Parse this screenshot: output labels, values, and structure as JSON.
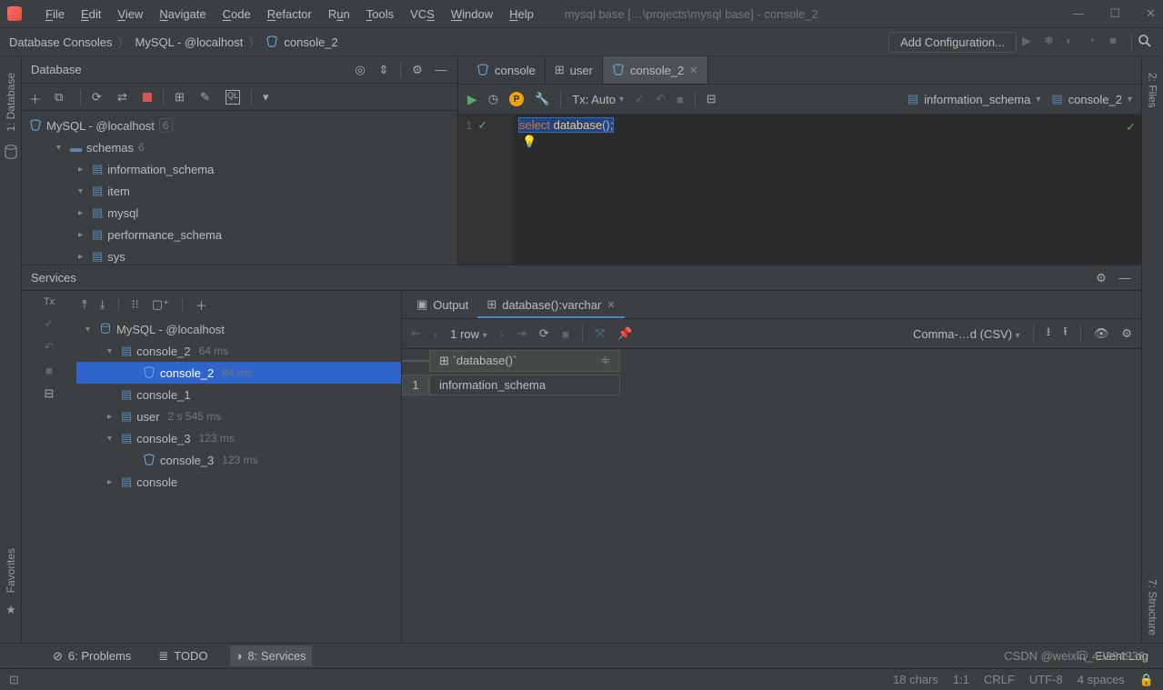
{
  "window": {
    "title": "mysql base […\\projects\\mysql base] - console_2"
  },
  "menubar": [
    "File",
    "Edit",
    "View",
    "Navigate",
    "Code",
    "Refactor",
    "Run",
    "Tools",
    "VCS",
    "Window",
    "Help"
  ],
  "navbar": {
    "crumbs": [
      "Database Consoles",
      "MySQL - @localhost",
      "console_2"
    ],
    "add_config": "Add Configuration..."
  },
  "leftstrip": {
    "tab": "1: Database"
  },
  "rightstrip": {
    "tab1": "2: Files",
    "tab2": "7: Structure"
  },
  "db_panel": {
    "title": "Database",
    "tree": {
      "root": "MySQL - @localhost",
      "root_badge": "6",
      "schemas_label": "schemas",
      "schemas_badge": "6",
      "schemas": [
        "information_schema",
        "item",
        "mysql",
        "performance_schema",
        "sys"
      ]
    }
  },
  "editor": {
    "tabs": [
      {
        "label": "console",
        "active": false,
        "closable": false
      },
      {
        "label": "user",
        "active": false,
        "closable": false,
        "icon": "table"
      },
      {
        "label": "console_2",
        "active": true,
        "closable": true
      }
    ],
    "toolbar": {
      "tx_label": "Tx: Auto",
      "datasource_left": "information_schema",
      "datasource_right": "console_2"
    },
    "code": {
      "line_no": "1",
      "kw": "select",
      "fn": "database",
      "rest": "();"
    }
  },
  "services": {
    "title": "Services",
    "tx_label": "Tx",
    "tree": [
      {
        "depth": 0,
        "arrow": "▾",
        "label": "MySQL - @localhost",
        "suffix": "",
        "sel": false,
        "icon": "db"
      },
      {
        "depth": 1,
        "arrow": "▾",
        "label": "console_2",
        "suffix": "64 ms",
        "sel": false,
        "icon": "run"
      },
      {
        "depth": 2,
        "arrow": "",
        "label": "console_2",
        "suffix": "64 ms",
        "sel": true,
        "icon": "query"
      },
      {
        "depth": 1,
        "arrow": "",
        "label": "console_1",
        "suffix": "",
        "sel": false,
        "icon": "run"
      },
      {
        "depth": 1,
        "arrow": "▸",
        "label": "user",
        "suffix": "2 s 545 ms",
        "sel": false,
        "icon": "run"
      },
      {
        "depth": 1,
        "arrow": "▾",
        "label": "console_3",
        "suffix": "123 ms",
        "sel": false,
        "icon": "run"
      },
      {
        "depth": 2,
        "arrow": "",
        "label": "console_3",
        "suffix": "123 ms",
        "sel": false,
        "icon": "query"
      },
      {
        "depth": 1,
        "arrow": "▸",
        "label": "console",
        "suffix": "",
        "sel": false,
        "icon": "run"
      }
    ],
    "output_tabs": [
      {
        "label": "Output",
        "active": false
      },
      {
        "label": "database():varchar",
        "active": true
      }
    ],
    "result_toolbar": {
      "rows": "1 row",
      "export": "Comma-…d (CSV)"
    },
    "result": {
      "header": "`database()`",
      "row_num": "1",
      "value": "information_schema"
    }
  },
  "bottombar": {
    "problems": "6: Problems",
    "todo": "TODO",
    "services": "8: Services",
    "eventlog": "Event Log"
  },
  "statusbar": {
    "chars": "18 chars",
    "pos": "1:1",
    "crlf": "CRLF",
    "enc": "UTF-8",
    "spaces": "4 spaces"
  },
  "watermark": "CSDN @weixin_43294936",
  "favorites_label": "Favorites"
}
